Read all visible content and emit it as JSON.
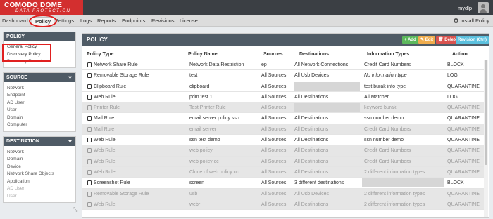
{
  "brand": {
    "line1": "COMODO DOME",
    "line2": "DATA PROTECTION"
  },
  "user": {
    "name": "mydlp"
  },
  "nav": {
    "items": [
      "Dashboard",
      "Policy",
      "Settings",
      "Logs",
      "Reports",
      "Endpoints",
      "Revisions",
      "License"
    ],
    "install": "Install Policy"
  },
  "sidebar": {
    "policy": {
      "title": "POLICY",
      "items": [
        "General Policy",
        "Discovery Policy",
        "Discovery Reports"
      ]
    },
    "source": {
      "title": "SOURCE",
      "items": [
        "Network",
        "Endpoint",
        "AD User",
        "User",
        "Domain",
        "Computer"
      ]
    },
    "destination": {
      "title": "DESTINATION",
      "items": [
        "Network",
        "Domain",
        "Device",
        "Network Share Objects",
        "Application",
        "AD User",
        "User"
      ]
    }
  },
  "main": {
    "title": "POLICY",
    "buttons": {
      "add": "+ Add",
      "edit": "✎ Edit",
      "delete": "🗑 Delete",
      "revision": "Revision (Ctrl)"
    },
    "columns": [
      "Policy Type",
      "Policy Name",
      "Sources",
      "Destinations",
      "Information Types",
      "Action"
    ],
    "rows": [
      {
        "type": "Network Share Rule",
        "name": "Network Data Restriction",
        "sources": "ep",
        "destinations": "All Network Connections",
        "info": "Credit Card Numbers",
        "action": "BLOCK",
        "enabled": true
      },
      {
        "type": "Removable Storage Rule",
        "name": "test",
        "sources": "All Sources",
        "destinations": "All Usb Devices",
        "info": "No information type",
        "action": "LOG",
        "enabled": true
      },
      {
        "type": "Clipboard Rule",
        "name": "clipboard",
        "sources": "All Sources",
        "destinations": "",
        "info": "test burak info type",
        "action": "QUARANTINE",
        "enabled": true
      },
      {
        "type": "Web Rule",
        "name": "pdm test 1",
        "sources": "All Sources",
        "destinations": "All Destinations",
        "info": "All Matcher",
        "action": "LOG",
        "enabled": true
      },
      {
        "type": "Printer Rule",
        "name": "Test Printer Rule",
        "sources": "All Sources",
        "destinations": "",
        "info": "keyword burak",
        "action": "QUARANTINE",
        "enabled": false
      },
      {
        "type": "Mail Rule",
        "name": "email server policy ssn",
        "sources": "All Sources",
        "destinations": "All Destinations",
        "info": "ssn number demo",
        "action": "QUARANTINE",
        "enabled": true
      },
      {
        "type": "Mail Rule",
        "name": "email server",
        "sources": "All Sources",
        "destinations": "All Destinations",
        "info": "Credit Card Numbers",
        "action": "QUARANTINE",
        "enabled": false
      },
      {
        "type": "Web Rule",
        "name": "ssn test demo",
        "sources": "All Sources",
        "destinations": "All Destinations",
        "info": "ssn number demo",
        "action": "QUARANTINE",
        "enabled": true
      },
      {
        "type": "Web Rule",
        "name": "web policy",
        "sources": "All Sources",
        "destinations": "All Destinations",
        "info": "Credit Card Numbers",
        "action": "QUARANTINE",
        "enabled": false
      },
      {
        "type": "Web Rule",
        "name": "web policy cc",
        "sources": "All Sources",
        "destinations": "All Destinations",
        "info": "Credit Card Numbers",
        "action": "QUARANTINE",
        "enabled": false
      },
      {
        "type": "Web Rule",
        "name": "Clone of web policy cc",
        "sources": "All Sources",
        "destinations": "All Destinations",
        "info": "2 different information types",
        "action": "QUARANTINE",
        "enabled": false
      },
      {
        "type": "Screenshot Rule",
        "name": "screen",
        "sources": "All Sources",
        "destinations": "3 different destinations",
        "info": "",
        "action": "BLOCK",
        "enabled": true
      },
      {
        "type": "Removable Storage Rule",
        "name": "usb",
        "sources": "All Sources",
        "destinations": "All Usb Devices",
        "info": "2 different information types",
        "action": "QUARANTINE",
        "enabled": false
      },
      {
        "type": "Web Rule",
        "name": "webr",
        "sources": "All Sources",
        "destinations": "All Destinations",
        "info": "2 different information types",
        "action": "QUARANTINE",
        "enabled": false
      }
    ]
  },
  "colors": {
    "brand_red": "#d32f2f",
    "header_dark": "#3b3f44",
    "panel_head": "#4f5b66",
    "annotation_red": "#e02020"
  }
}
